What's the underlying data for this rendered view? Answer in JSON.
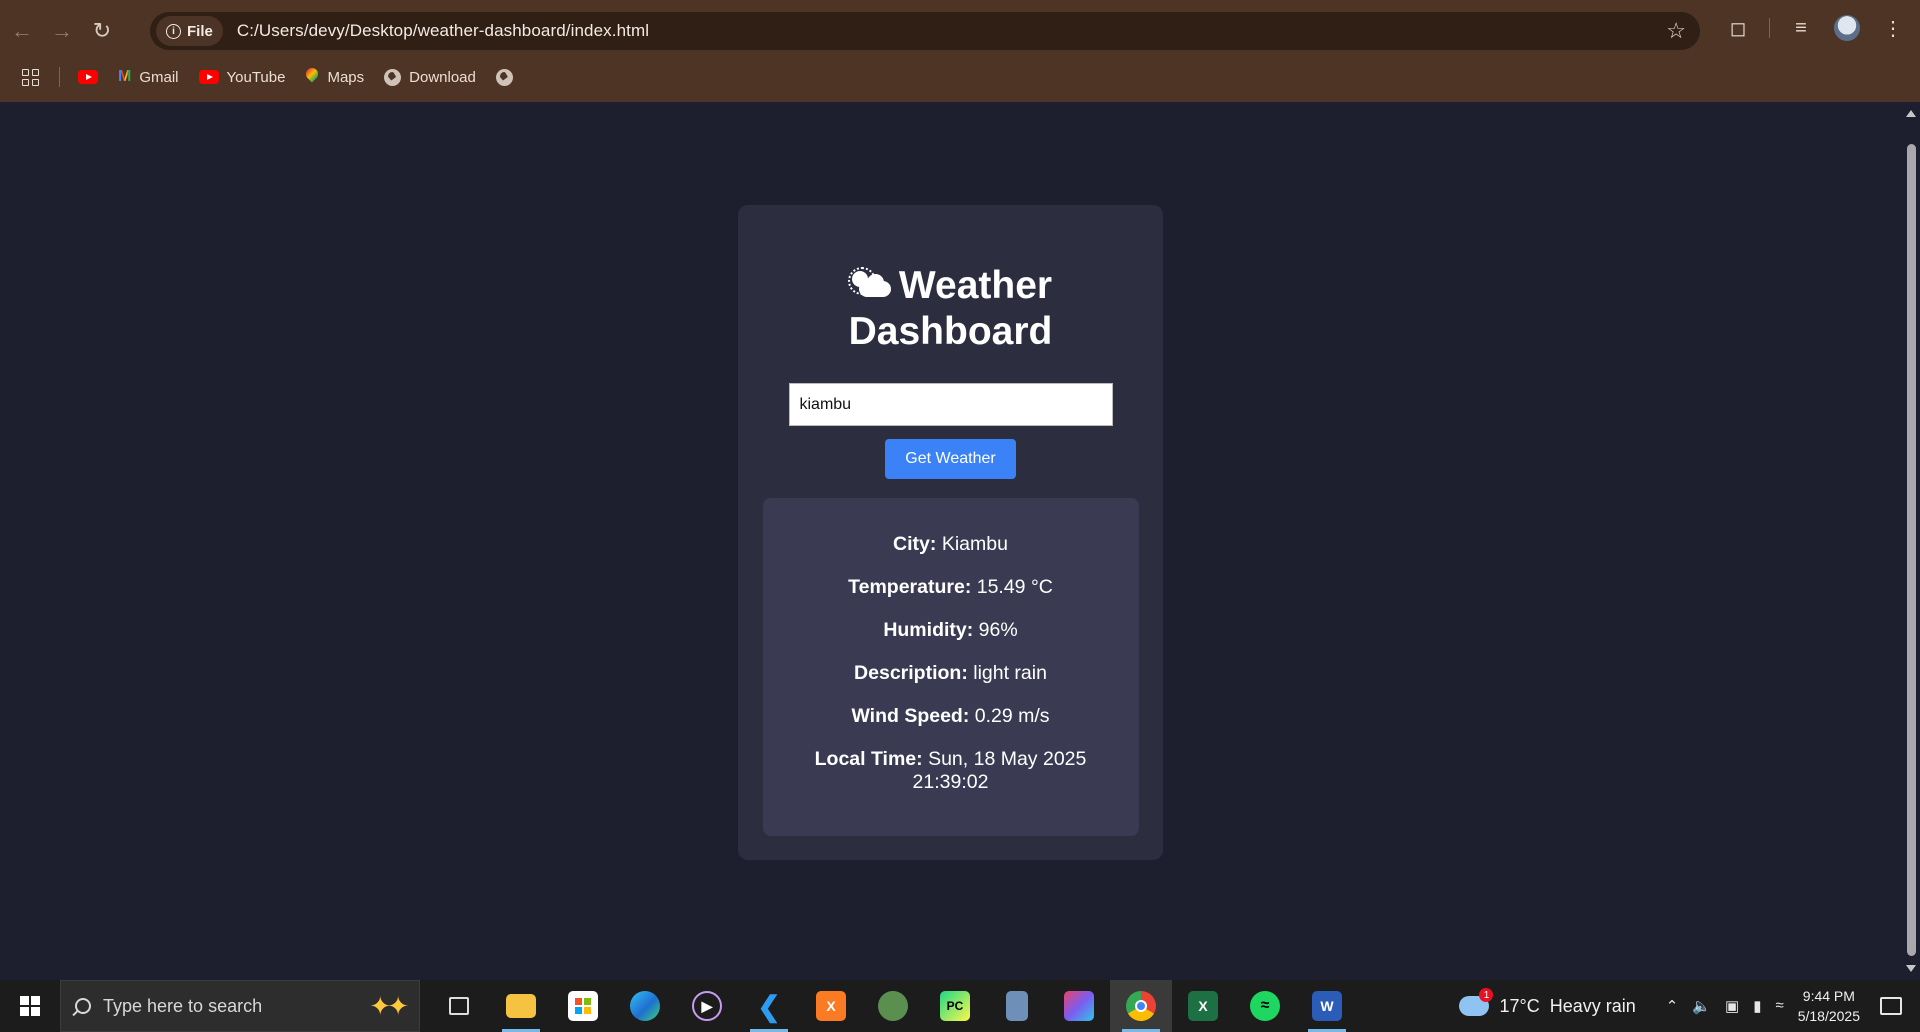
{
  "browser": {
    "file_chip_label": "File",
    "url": "C:/Users/devy/Desktop/weather-dashboard/index.html",
    "bookmarks": [
      {
        "label": "",
        "icon": "youtube-icon"
      },
      {
        "label": "Gmail",
        "icon": "gmail-icon"
      },
      {
        "label": "YouTube",
        "icon": "youtube-icon"
      },
      {
        "label": "Maps",
        "icon": "maps-icon"
      },
      {
        "label": "Download",
        "icon": "globe-icon"
      },
      {
        "label": "",
        "icon": "globe-icon"
      }
    ]
  },
  "app": {
    "title": "Weather Dashboard",
    "title_icon": "sun-behind-cloud-icon",
    "search": {
      "value": "kiambu",
      "placeholder": ""
    },
    "button_label": "Get Weather",
    "results": {
      "city": {
        "label": "City:",
        "value": "Kiambu"
      },
      "temperature": {
        "label": "Temperature:",
        "value": "15.49 °C"
      },
      "humidity": {
        "label": "Humidity:",
        "value": "96%"
      },
      "description": {
        "label": "Description:",
        "value": "light rain"
      },
      "wind_speed": {
        "label": "Wind Speed:",
        "value": "0.29 m/s"
      },
      "local_time": {
        "label": "Local Time:",
        "value": "Sun, 18 May 2025 21:39:02"
      }
    }
  },
  "taskbar": {
    "search_placeholder": "Type here to search",
    "weather": {
      "temp": "17°C",
      "condition": "Heavy rain",
      "badge": "1"
    },
    "clock": {
      "time": "9:44 PM",
      "date": "5/18/2025"
    }
  },
  "colors": {
    "page_bg": "#1e1f2e",
    "card_bg": "#2c2d3f",
    "result_bg": "#3a3b52",
    "button": "#3b82f6",
    "chrome_bg": "#4e3424"
  }
}
